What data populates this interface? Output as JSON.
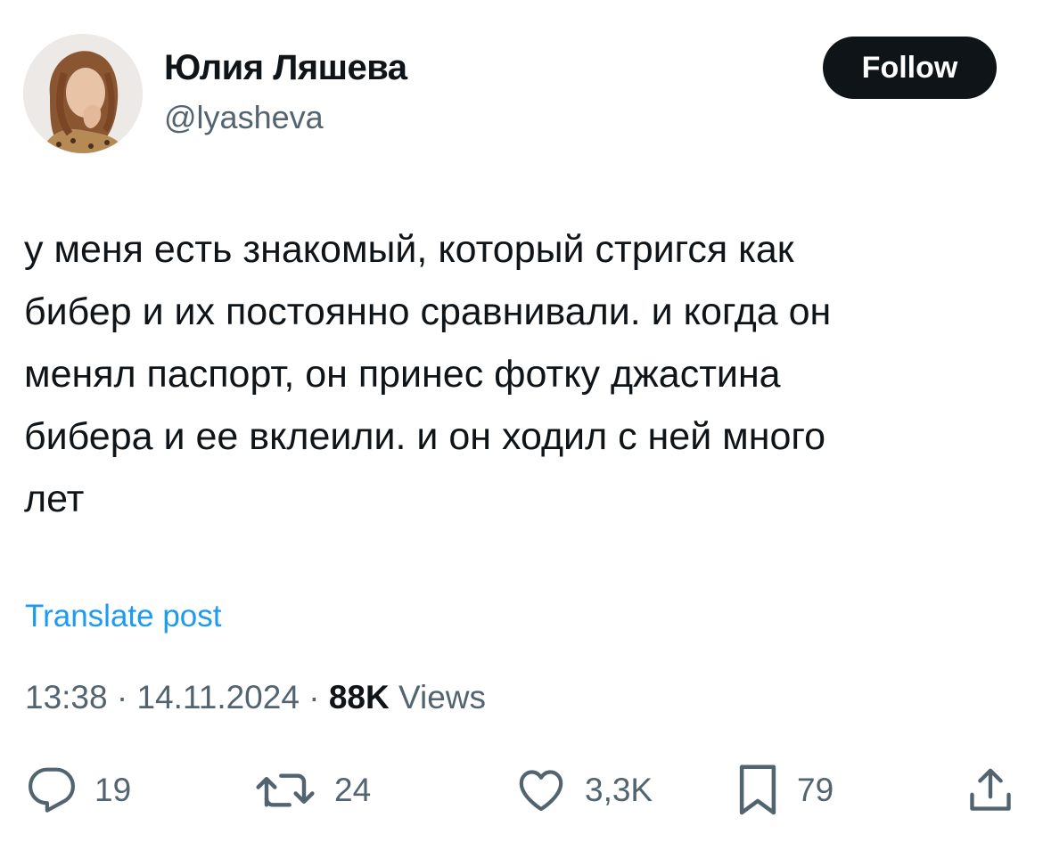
{
  "author": {
    "display_name": "Юлия Ляшева",
    "handle": "@lyasheva"
  },
  "follow_label": "Follow",
  "tweet": {
    "text": "у меня есть знакомый, который стригся как\nбибер и их постоянно сравнивали. и когда он\nменял паспорт, он принес фотку джастина\nбибера и ее вклеили. и он ходил с ней много\nлет",
    "translate_label": "Translate post"
  },
  "meta": {
    "time": "13:38",
    "separator": " · ",
    "date": "14.11.2024",
    "views_count": "88K",
    "views_label": "Views"
  },
  "actions": {
    "replies": "19",
    "reposts": "24",
    "likes": "3,3K",
    "bookmarks": "79"
  },
  "colors": {
    "text": "#0f1419",
    "secondary": "#536471",
    "link": "#1d9bf0",
    "button_bg": "#0f1419"
  },
  "icons": [
    "reply-icon",
    "repost-icon",
    "like-icon",
    "bookmark-icon",
    "share-icon"
  ]
}
